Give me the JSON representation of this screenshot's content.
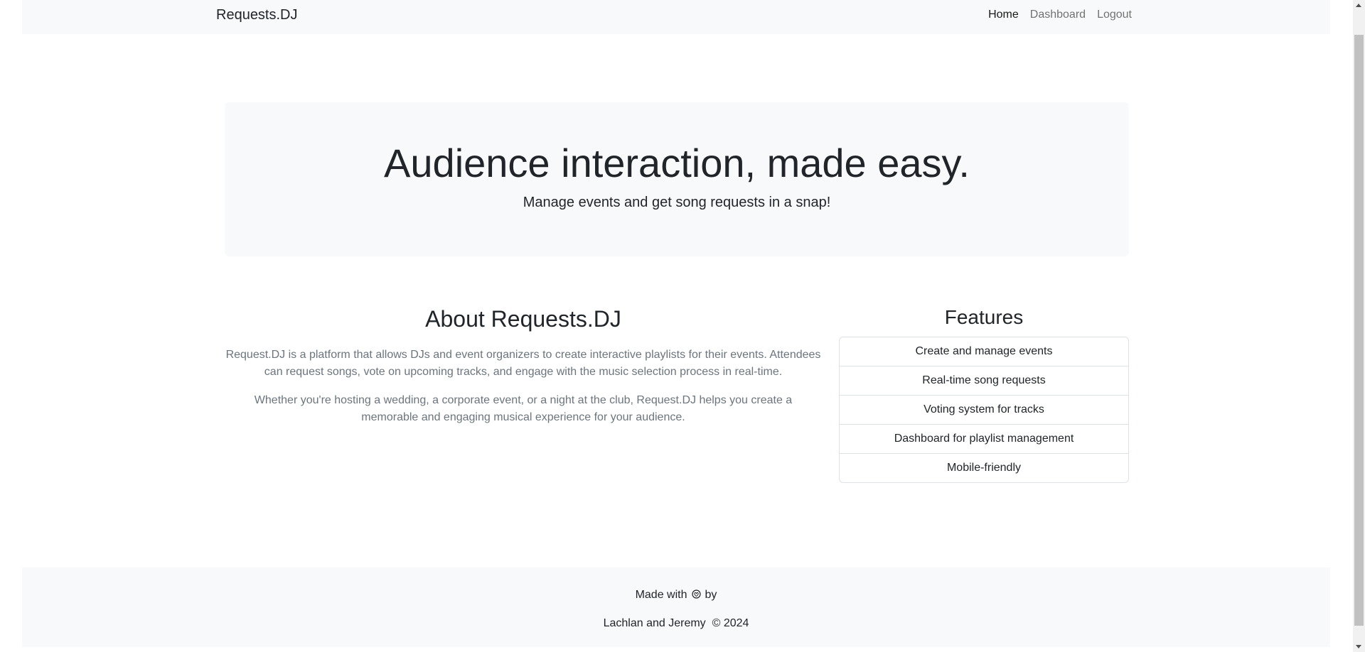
{
  "navbar": {
    "brand": "Requests.DJ",
    "links": [
      {
        "label": "Home",
        "active": true
      },
      {
        "label": "Dashboard",
        "active": false
      },
      {
        "label": "Logout",
        "active": false
      }
    ]
  },
  "hero": {
    "title": "Audience interaction, made easy.",
    "subtitle": "Manage events and get song requests in a snap!"
  },
  "about": {
    "title": "About Requests.DJ",
    "paragraphs": [
      "Request.DJ is a platform that allows DJs and event organizers to create interactive playlists for their events. Attendees can request songs, vote on upcoming tracks, and engage with the music selection process in real-time.",
      "Whether you're hosting a wedding, a corporate event, or a night at the club, Request.DJ helps you create a memorable and engaging musical experience for your audience."
    ]
  },
  "features": {
    "title": "Features",
    "items": [
      "Create and manage events",
      "Real-time song requests",
      "Voting system for tracks",
      "Dashboard for playlist management",
      "Mobile-friendly"
    ]
  },
  "footer": {
    "made_with": "Made with",
    "heart_icon": "heart-icon",
    "by": "by",
    "authors": "Lachlan and Jeremy",
    "copyright": "© 2024"
  },
  "colors": {
    "navbar_bg": "#f8f9fa",
    "text": "#212529",
    "muted": "#6c757d",
    "border": "#dee2e6"
  }
}
